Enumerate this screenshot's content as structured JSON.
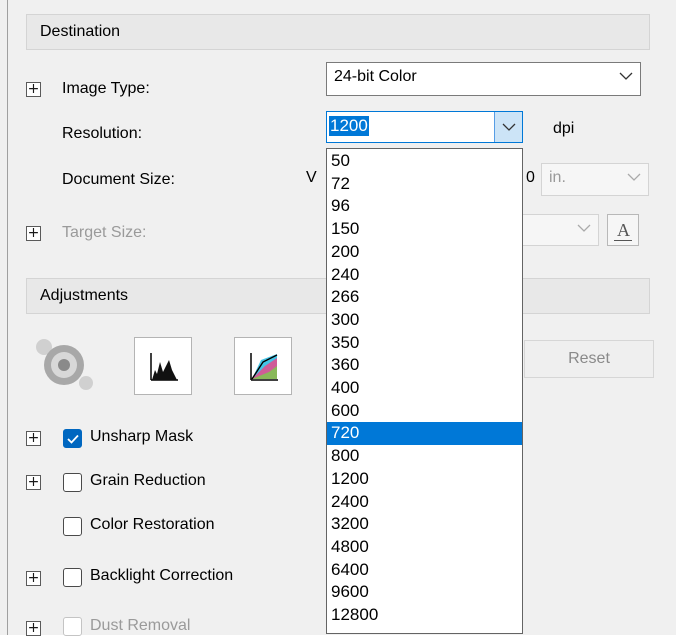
{
  "destination": {
    "header": "Destination",
    "image_type": {
      "label": "Image Type:",
      "value": "24-bit Color"
    },
    "resolution": {
      "label": "Resolution:",
      "value": "1200",
      "unit": "dpi"
    },
    "document_size": {
      "label": "Document Size:",
      "width_fragment": "V",
      "height_fragment": "0",
      "unit": "in."
    },
    "target_size": {
      "label": "Target Size:"
    }
  },
  "resolution_dropdown": {
    "options": [
      "50",
      "72",
      "96",
      "150",
      "200",
      "240",
      "266",
      "300",
      "350",
      "360",
      "400",
      "600",
      "720",
      "800",
      "1200",
      "2400",
      "3200",
      "4800",
      "6400",
      "9600",
      "12800"
    ],
    "highlighted": "720"
  },
  "adjustments": {
    "header": "Adjustments",
    "reset_label": "Reset",
    "tools": [
      "auto-exposure-icon",
      "histogram-icon",
      "tone-curve-icon"
    ],
    "options": [
      {
        "label": "Unsharp Mask",
        "checked": true,
        "expandable": true,
        "disabled": false
      },
      {
        "label": "Grain Reduction",
        "checked": false,
        "expandable": true,
        "disabled": false
      },
      {
        "label": "Color Restoration",
        "checked": false,
        "expandable": false,
        "disabled": false
      },
      {
        "label": "Backlight Correction",
        "checked": false,
        "expandable": true,
        "disabled": false
      },
      {
        "label": "Dust Removal",
        "checked": false,
        "expandable": true,
        "disabled": true
      }
    ]
  },
  "colors": {
    "accent": "#0078d7",
    "checkbox_checked": "#0067c0",
    "panel_bg": "#f0f0f0",
    "disabled_text": "#9a9a9a"
  }
}
